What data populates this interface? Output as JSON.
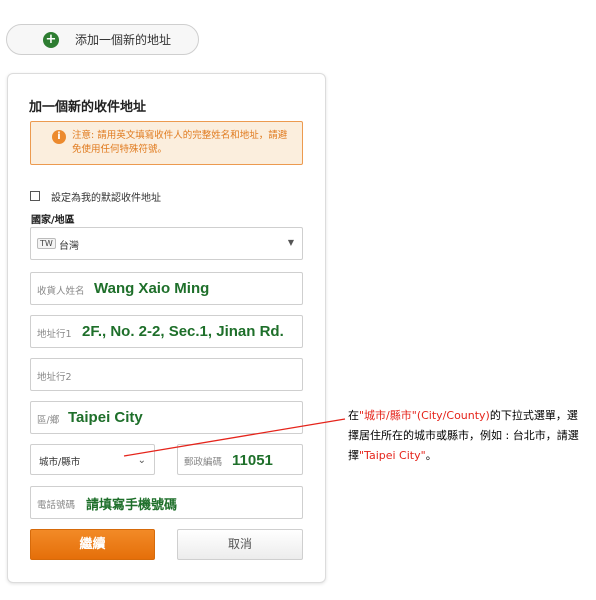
{
  "add_button": {
    "label": "添加一個新的地址"
  },
  "form": {
    "title": "加一個新的收件地址",
    "notice": "注意: 請用英文填寫收件人的完整姓名和地址，請避免使用任何特殊符號。",
    "default_checkbox_label": "設定為我的默認收件地址",
    "country_label": "國家/地區",
    "country": {
      "code": "TW",
      "value": "台灣"
    },
    "fields": {
      "recipient_placeholder": "收貨人姓名",
      "recipient_value": "Wang Xaio Ming",
      "address1_placeholder": "地址行1",
      "address1_value": "2F., No. 2-2, Sec.1, Jinan Rd.",
      "address2_placeholder": "地址行2",
      "district_placeholder": "區/鄉",
      "district_value": "Taipei City",
      "city_placeholder": "城市/縣市",
      "zip_placeholder": "郵政編碼",
      "zip_value": "11051",
      "phone_placeholder": "電話號碼",
      "phone_value": "請填寫手機號碼"
    },
    "continue_label": "繼續",
    "cancel_label": "取消"
  },
  "annotation": {
    "prefix": "在",
    "highlight1": "\"城市/縣市\"(City/County)",
    "mid": "的下拉式選單，選擇居住所在的城市或縣市，例如 : 台北市，請選擇",
    "highlight2": "\"Taipei City\"",
    "suffix": "。"
  },
  "colors": {
    "accent": "#e56f0a",
    "value_green": "#1e6f2a",
    "annotation_red": "#e5241b"
  }
}
